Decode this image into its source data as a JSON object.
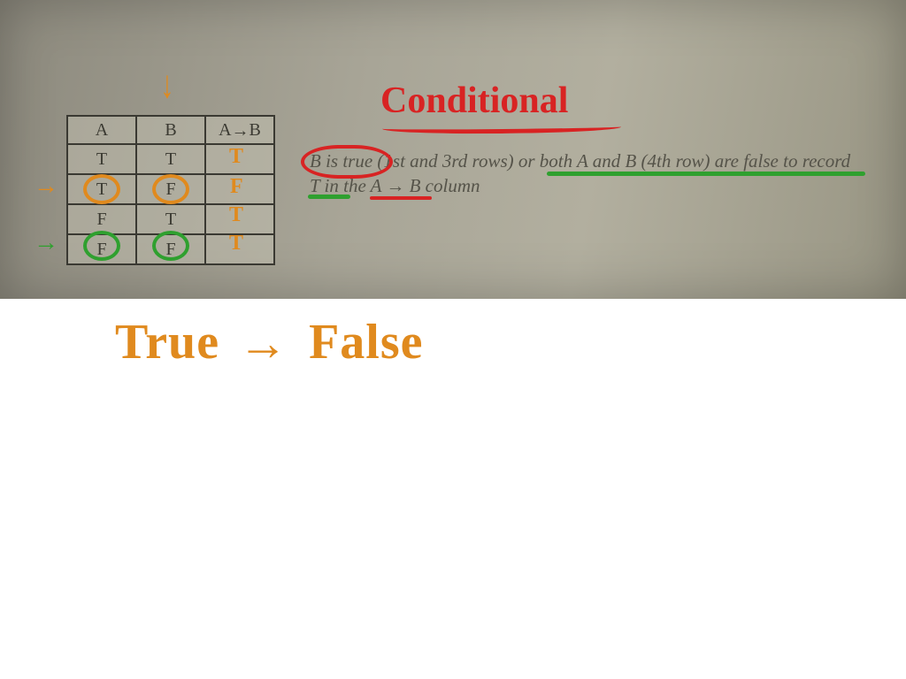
{
  "chart_data": {
    "type": "table",
    "title": "Truth table for conditional A → B",
    "columns": [
      "A",
      "B",
      "A → B"
    ],
    "rows": [
      [
        "T",
        "T",
        "T"
      ],
      [
        "T",
        "F",
        "F"
      ],
      [
        "F",
        "T",
        "T"
      ],
      [
        "F",
        "F",
        "T"
      ]
    ]
  },
  "table": {
    "headers": {
      "a": "A",
      "b": "B",
      "ab": "A → B"
    },
    "rows": [
      {
        "a": "T",
        "b": "T",
        "ab": "T"
      },
      {
        "a": "T",
        "b": "F",
        "ab": "F"
      },
      {
        "a": "F",
        "b": "T",
        "ab": "T"
      },
      {
        "a": "F",
        "b": "F",
        "ab": "T"
      }
    ]
  },
  "annotations": {
    "title": "Conditional",
    "explanation": "B is true (1st and 3rd rows) or both A and B (4th row) are false to record T in the A → B column",
    "bottom_true": "True",
    "bottom_false": "False",
    "bottom_arrow": "→"
  },
  "colors": {
    "orange": "#e08a1e",
    "red": "#d82323",
    "green": "#2fa02f"
  }
}
